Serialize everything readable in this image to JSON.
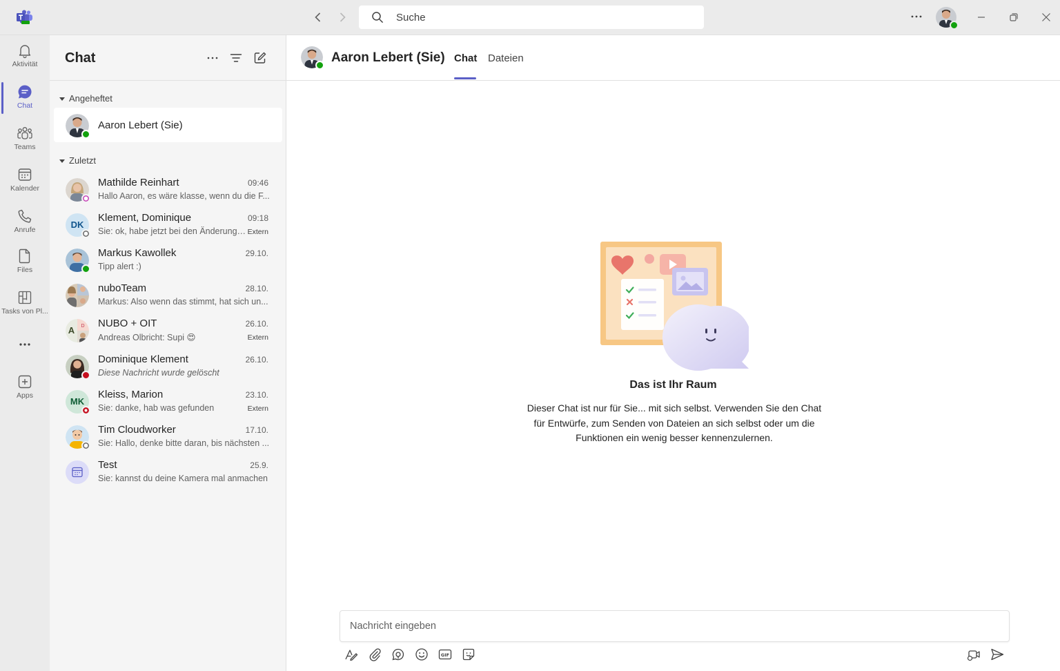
{
  "search": {
    "placeholder": "Suche"
  },
  "rail": {
    "items": [
      {
        "label": "Aktivität",
        "icon": "bell-icon"
      },
      {
        "label": "Chat",
        "icon": "chat-icon"
      },
      {
        "label": "Teams",
        "icon": "teams-icon"
      },
      {
        "label": "Kalender",
        "icon": "calendar-icon"
      },
      {
        "label": "Anrufe",
        "icon": "phone-icon"
      },
      {
        "label": "Files",
        "icon": "file-icon"
      },
      {
        "label": "Tasks von Pl...",
        "icon": "planner-icon"
      },
      {
        "label": "Apps",
        "icon": "add-app-icon"
      }
    ],
    "active": "Chat"
  },
  "list": {
    "title": "Chat",
    "pinned_header": "Angeheftet",
    "recent_header": "Zuletzt",
    "pinned": [
      {
        "name": "Aaron Lebert (Sie)"
      }
    ],
    "chats": [
      {
        "name": "Mathilde Reinhart",
        "time": "09:46",
        "preview": "Hallo Aaron, es wäre klasse, wenn du die F...",
        "extern": ""
      },
      {
        "name": "Klement, Dominique",
        "initials": "DK",
        "time": "09:18",
        "preview": "Sie: ok, habe jetzt bei den Änderungen...",
        "extern": "Extern"
      },
      {
        "name": "Markus Kawollek",
        "time": "29.10.",
        "preview": "Tipp alert :)",
        "extern": ""
      },
      {
        "name": "nuboTeam",
        "time": "28.10.",
        "preview": "Markus: Also wenn das stimmt, hat sich un...",
        "extern": ""
      },
      {
        "name": "NUBO + OIT",
        "initials": "A",
        "time": "26.10.",
        "preview": "Andreas Olbricht: Supi 😍",
        "extern": "Extern"
      },
      {
        "name": "Dominique Klement",
        "time": "26.10.",
        "preview": "Diese Nachricht wurde gelöscht",
        "extern": ""
      },
      {
        "name": "Kleiss, Marion",
        "initials": "MK",
        "time": "23.10.",
        "preview": "Sie: danke, hab was gefunden",
        "extern": "Extern"
      },
      {
        "name": "Tim Cloudworker",
        "time": "17.10.",
        "preview": "Sie: Hallo, denke bitte daran, bis nächsten ...",
        "extern": ""
      },
      {
        "name": "Test",
        "time": "25.9.",
        "preview": "Sie: kannst du deine Kamera mal anmachen",
        "extern": ""
      }
    ]
  },
  "main": {
    "title": "Aaron Lebert (Sie)",
    "tabs": [
      "Chat",
      "Dateien"
    ],
    "active_tab": "Chat",
    "empty_title": "Das ist Ihr Raum",
    "empty_desc": "Dieser Chat ist nur für Sie... mit sich selbst. Verwenden Sie den Chat für Entwürfe, zum Senden von Dateien an sich selbst oder um die Funktionen ein wenig besser kennenzulernen.",
    "composer_placeholder": "Nachricht eingeben"
  },
  "colors": {
    "accent": "#5b5fc7",
    "available": "#13a10e",
    "busy": "#c50f1f"
  }
}
